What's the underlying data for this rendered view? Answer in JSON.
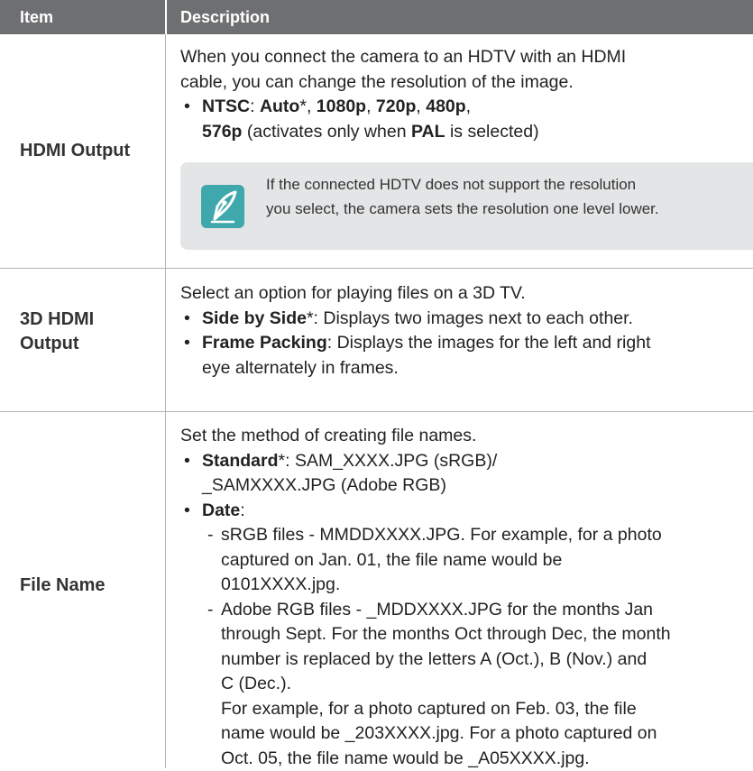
{
  "header": {
    "item": "Item",
    "description": "Description"
  },
  "rows": [
    {
      "item": "HDMI Output",
      "lines": [
        "When you connect the camera to an HDTV with an HDMI",
        "cable, you can change the resolution of the image."
      ],
      "bullet1": {
        "ntsc": "NTSC",
        "colon": ": ",
        "auto": "Auto",
        "star": "*",
        "comma": ", ",
        "p1080": "1080p",
        "p720": "720p",
        "p480": "480p",
        "trail": ","
      },
      "bullet1_cont": {
        "p576": "576p",
        "text1": " (activates only when ",
        "pal": "PAL",
        "text2": " is selected)"
      },
      "note": [
        "If the connected HDTV does not support the resolution",
        "you select, the camera sets the resolution one level lower."
      ]
    },
    {
      "item_line1": "3D HDMI",
      "item_line2": "Output",
      "intro": "Select an option for playing files on a 3D TV.",
      "b1_label": "Side by Side",
      "b1_star": "*",
      "b1_text": ": Displays two images next to each other.",
      "b2_label": "Frame Packing",
      "b2_text": ": Displays the images for the left and right",
      "b2_cont": "eye alternately in frames."
    },
    {
      "item": "File Name",
      "intro": "Set the method of creating file names.",
      "standard_label": "Standard",
      "standard_star": "*",
      "standard_text": ": SAM_XXXX.JPG (sRGB)/",
      "standard_cont": "_SAMXXXX.JPG (Adobe RGB)",
      "date_label": "Date",
      "date_colon": ":",
      "srgb": [
        "sRGB files - MMDDXXXX.JPG. For example, for a photo",
        "captured on Jan. 01, the file name would be",
        "0101XXXX.jpg."
      ],
      "adobe": [
        "Adobe RGB files - _MDDXXXX.JPG for the months Jan",
        "through Sept. For the months Oct through Dec, the month",
        "number is replaced by the letters A (Oct.), B (Nov.) and",
        "C (Dec.).",
        "For example, for a photo captured on Feb. 03, the file",
        "name would be _203XXXX.jpg. For a photo captured on",
        "Oct. 05, the file name would be _A05XXXX.jpg."
      ]
    }
  ],
  "colors": {
    "header_bg": "#6e6f71",
    "note_bg": "#e4e5e6",
    "note_icon": "#3fa8ac",
    "rule": "#b5b5b5"
  },
  "icons": {
    "note": "note-pen-icon"
  }
}
